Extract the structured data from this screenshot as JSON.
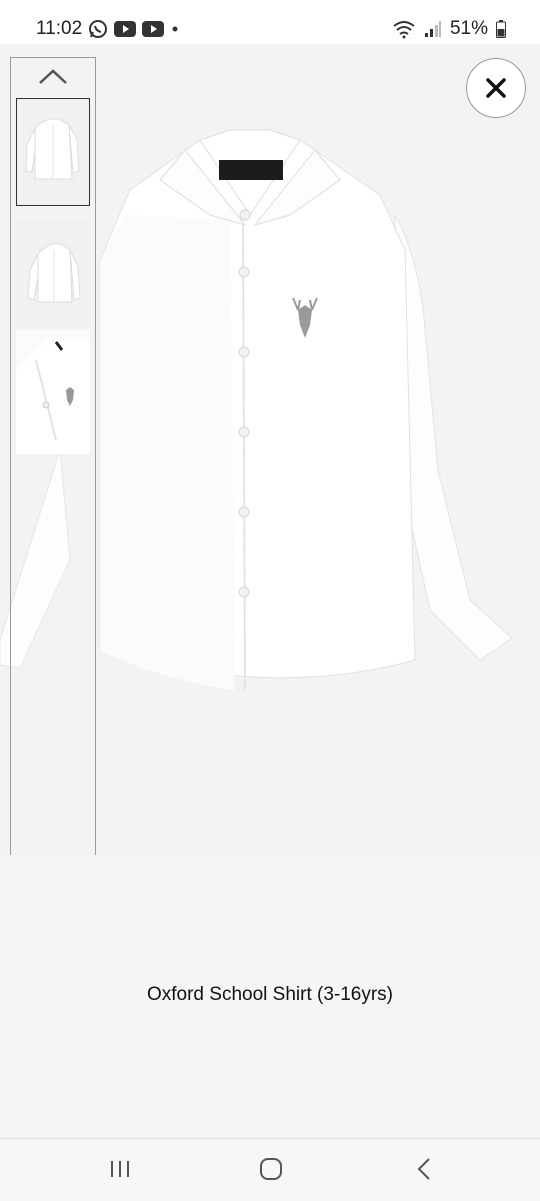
{
  "status_bar": {
    "time": "11:02",
    "battery": "51%"
  },
  "product": {
    "title": "Oxford School Shirt (3-16yrs)"
  },
  "colors": {
    "background": "#f5f5f4",
    "shirt": "#ffffff"
  }
}
